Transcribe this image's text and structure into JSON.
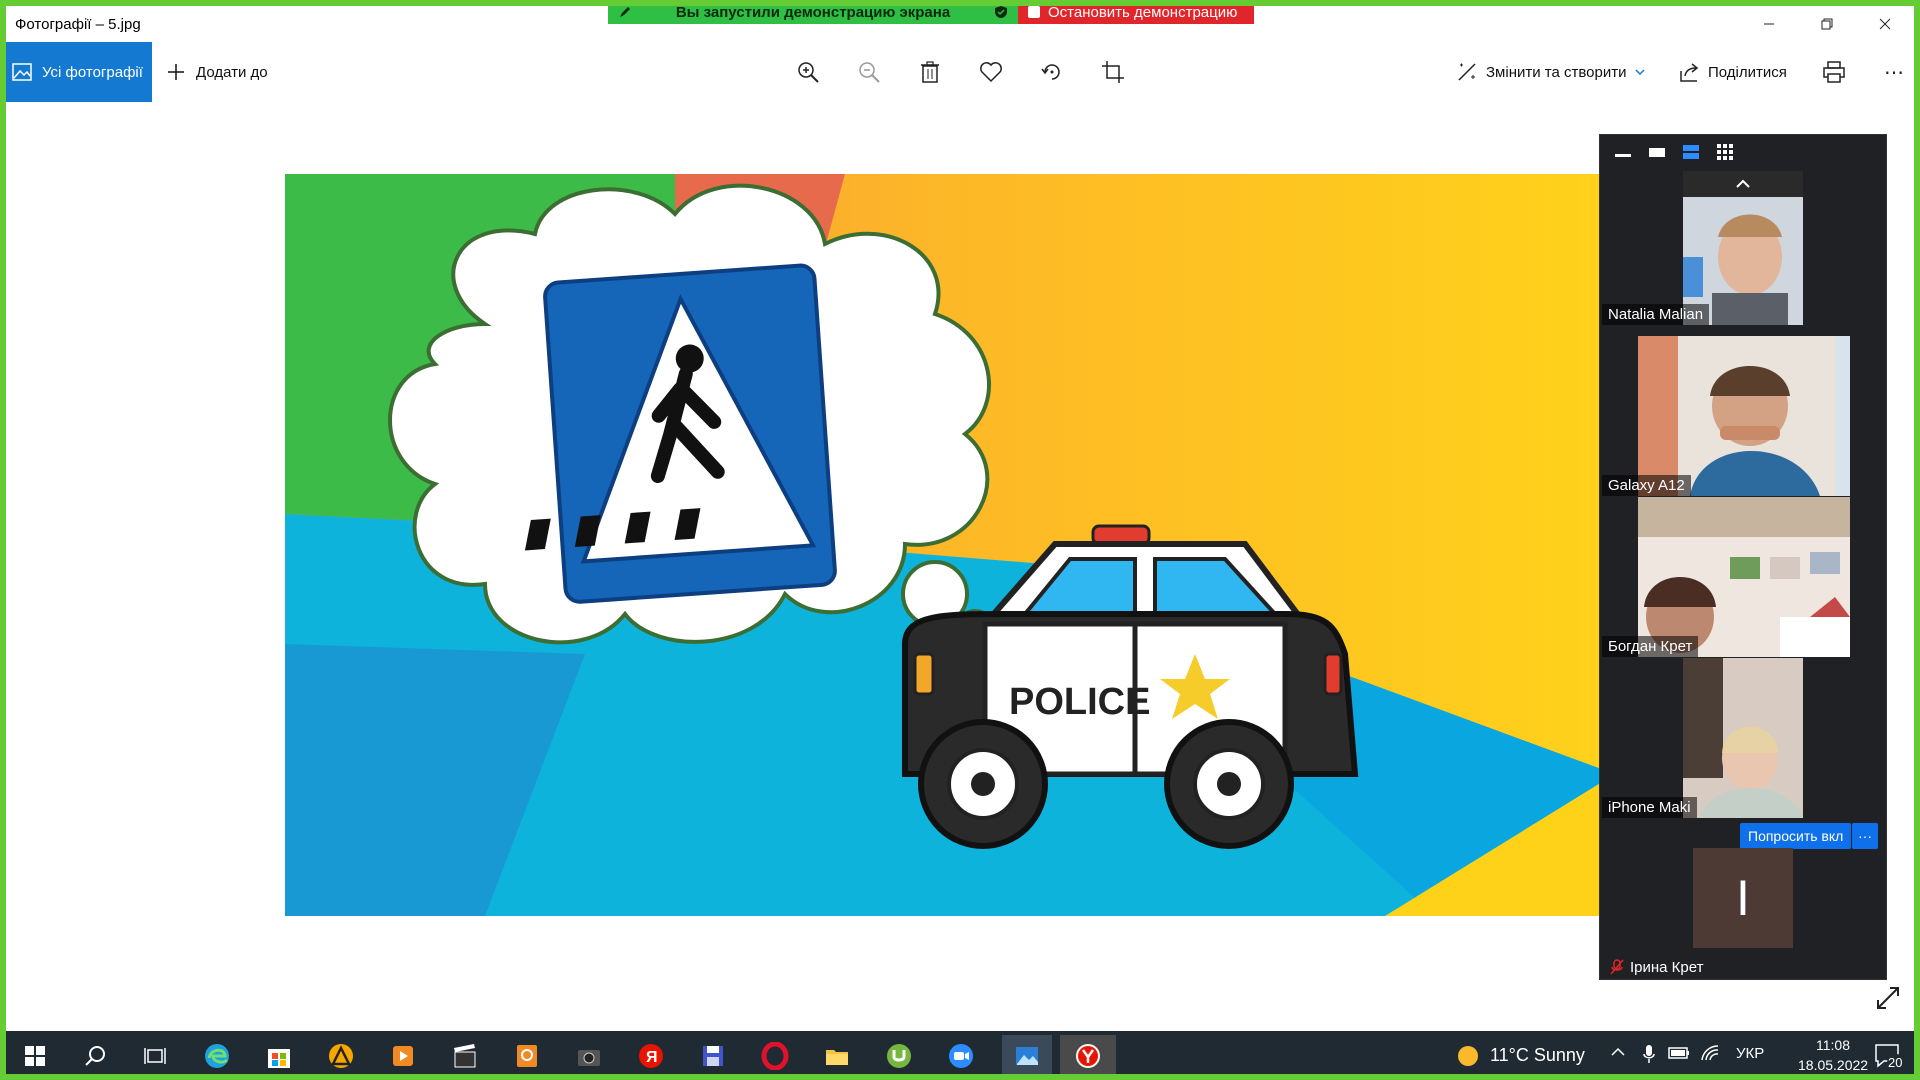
{
  "window": {
    "title": "Фотографії – 5.jpg"
  },
  "share_banner": {
    "message": "Вы запустили демонстрацию экрана",
    "stop_label": "Остановить демонстрацию"
  },
  "toolbar": {
    "all_photos_label": "Усі фотографії",
    "add_to_label": "Додати до",
    "edit_create_label": "Змінити та створити",
    "share_label": "Поділитися",
    "more_label": "⋯"
  },
  "photo": {
    "police_text": "POLICE"
  },
  "zoom": {
    "participants": [
      {
        "name": "Natalia Malian"
      },
      {
        "name": "Galaxy A12"
      },
      {
        "name": "Богдан Крет"
      },
      {
        "name": "iPhone Maki"
      }
    ],
    "ask_button": "Попросить вкл",
    "more_button": "···",
    "avatar_letter": "I",
    "muted_participant": "Ірина Крет"
  },
  "taskbar": {
    "weather": "11°C  Sunny",
    "language": "УКР",
    "time": "11:08",
    "date": "18.05.2022",
    "notifications": "20"
  },
  "colors": {
    "accent": "#1479d1",
    "share_green": "#2fbf44",
    "share_red": "#e0262b",
    "zoom_blue": "#0e71eb",
    "taskbar": "#1f2a33"
  }
}
